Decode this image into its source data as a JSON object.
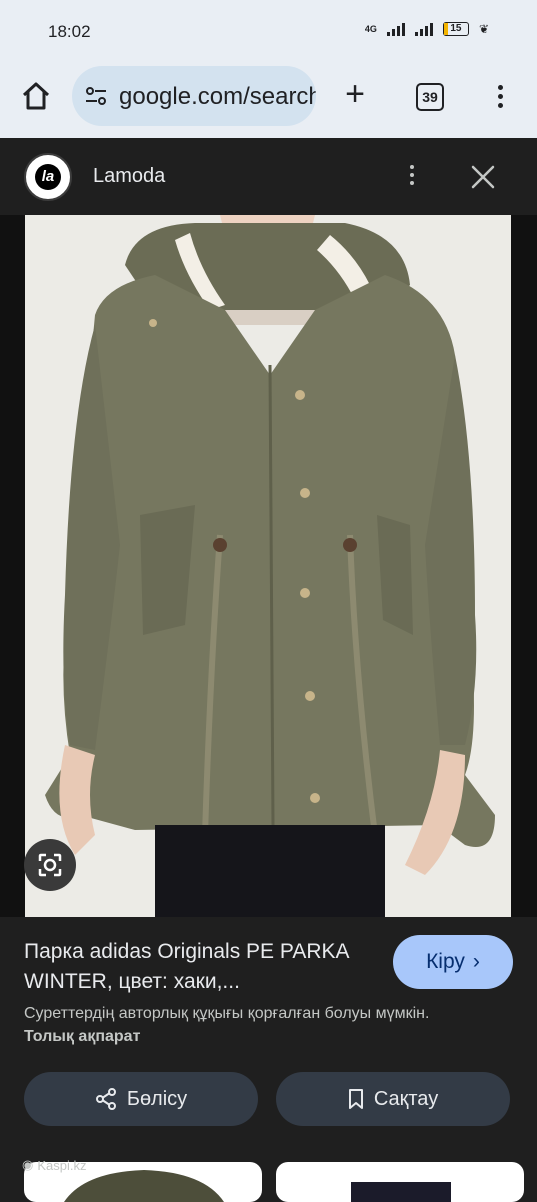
{
  "status_bar": {
    "time": "18:02",
    "network": "4G",
    "battery": "15",
    "battery_level": 0.15
  },
  "browser": {
    "url": "google.com/search",
    "tab_count": "39"
  },
  "site": {
    "logo_text": "la",
    "name": "Lamoda"
  },
  "product": {
    "title": "Парка adidas Originals PE PARKA WINTER, цвет: хаки,...",
    "visit_label": "Кіру",
    "copyright_note": "Суреттердің авторлық құқығы қорғалған болуы мүмкін.",
    "learn_more": "Толық ақпарат",
    "share_label": "Бөлісу",
    "save_label": "Сақтау"
  },
  "related": {
    "source": "Kaspi.kz"
  },
  "colors": {
    "accent": "#a8c7fa",
    "coat": "#76775f",
    "panel": "#1f1f1f"
  }
}
